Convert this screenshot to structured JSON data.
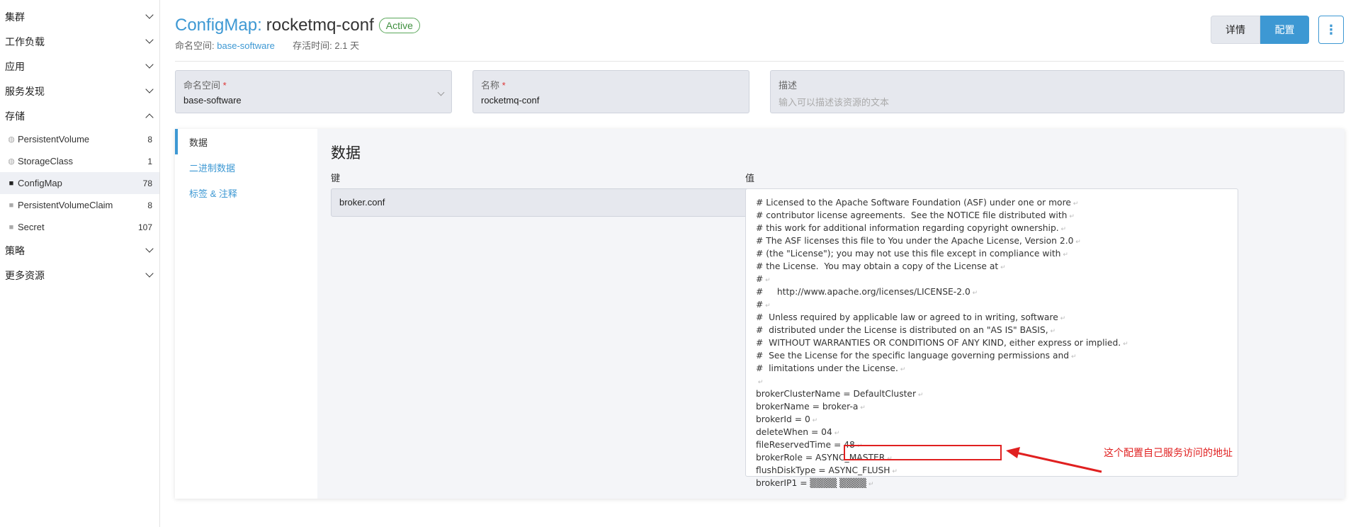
{
  "sidebar": {
    "groups": [
      {
        "label": "集群"
      },
      {
        "label": "工作负载"
      },
      {
        "label": "应用"
      },
      {
        "label": "服务发现"
      },
      {
        "label": "存储"
      },
      {
        "label": "策略"
      },
      {
        "label": "更多资源"
      }
    ],
    "storage_items": [
      {
        "label": "PersistentVolume",
        "count": "8",
        "icon": "globe-icon"
      },
      {
        "label": "StorageClass",
        "count": "1",
        "icon": "globe-icon"
      },
      {
        "label": "ConfigMap",
        "count": "78",
        "icon": "folder-icon"
      },
      {
        "label": "PersistentVolumeClaim",
        "count": "8",
        "icon": "folder-icon"
      },
      {
        "label": "Secret",
        "count": "107",
        "icon": "folder-icon"
      }
    ]
  },
  "header": {
    "kind": "ConfigMap:",
    "name": "rocketmq-conf",
    "status": "Active",
    "namespace_label": "命名空间:",
    "namespace_value": "base-software",
    "age_label": "存活时间:",
    "age_value": "2.1 天",
    "detail_button": "详情",
    "config_button": "配置",
    "more_button": "⋮"
  },
  "form": {
    "namespace": {
      "label": "命名空间",
      "required": "*",
      "value": "base-software"
    },
    "name": {
      "label": "名称",
      "required": "*",
      "value": "rocketmq-conf"
    },
    "description": {
      "label": "描述",
      "placeholder": "输入可以描述该资源的文本"
    }
  },
  "tabs": [
    {
      "label": "数据"
    },
    {
      "label": "二进制数据"
    },
    {
      "label": "标签 & 注释"
    }
  ],
  "data_section": {
    "title": "数据",
    "key_label": "键",
    "value_label": "值",
    "key": "broker.conf",
    "lines": [
      "# Licensed to the Apache Software Foundation (ASF) under one or more",
      "# contributor license agreements.  See the NOTICE file distributed with",
      "# this work for additional information regarding copyright ownership.",
      "# The ASF licenses this file to You under the Apache License, Version 2.0",
      "# (the \"License\"); you may not use this file except in compliance with",
      "# the License.  You may obtain a copy of the License at",
      "#",
      "#     http://www.apache.org/licenses/LICENSE-2.0",
      "#",
      "#  Unless required by applicable law or agreed to in writing, software",
      "#  distributed under the License is distributed on an \"AS IS\" BASIS,",
      "#  WITHOUT WARRANTIES OR CONDITIONS OF ANY KIND, either express or implied.",
      "#  See the License for the specific language governing permissions and",
      "#  limitations under the License.",
      "",
      "brokerClusterName = DefaultCluster",
      "brokerName = broker-a",
      "brokerId = 0",
      "deleteWhen = 04",
      "fileReservedTime = 48",
      "brokerRole = ASYNC_MASTER",
      "flushDiskType = ASYNC_FLUSH",
      "brokerIP1 = ▒▒▒▒ ▒▒▒▒"
    ]
  },
  "annotation": {
    "text": "这个配置自己服务访问的地址",
    "color": "#e02020"
  },
  "colors": {
    "accent": "#3d98d3",
    "status_green": "#3f8f3f"
  }
}
